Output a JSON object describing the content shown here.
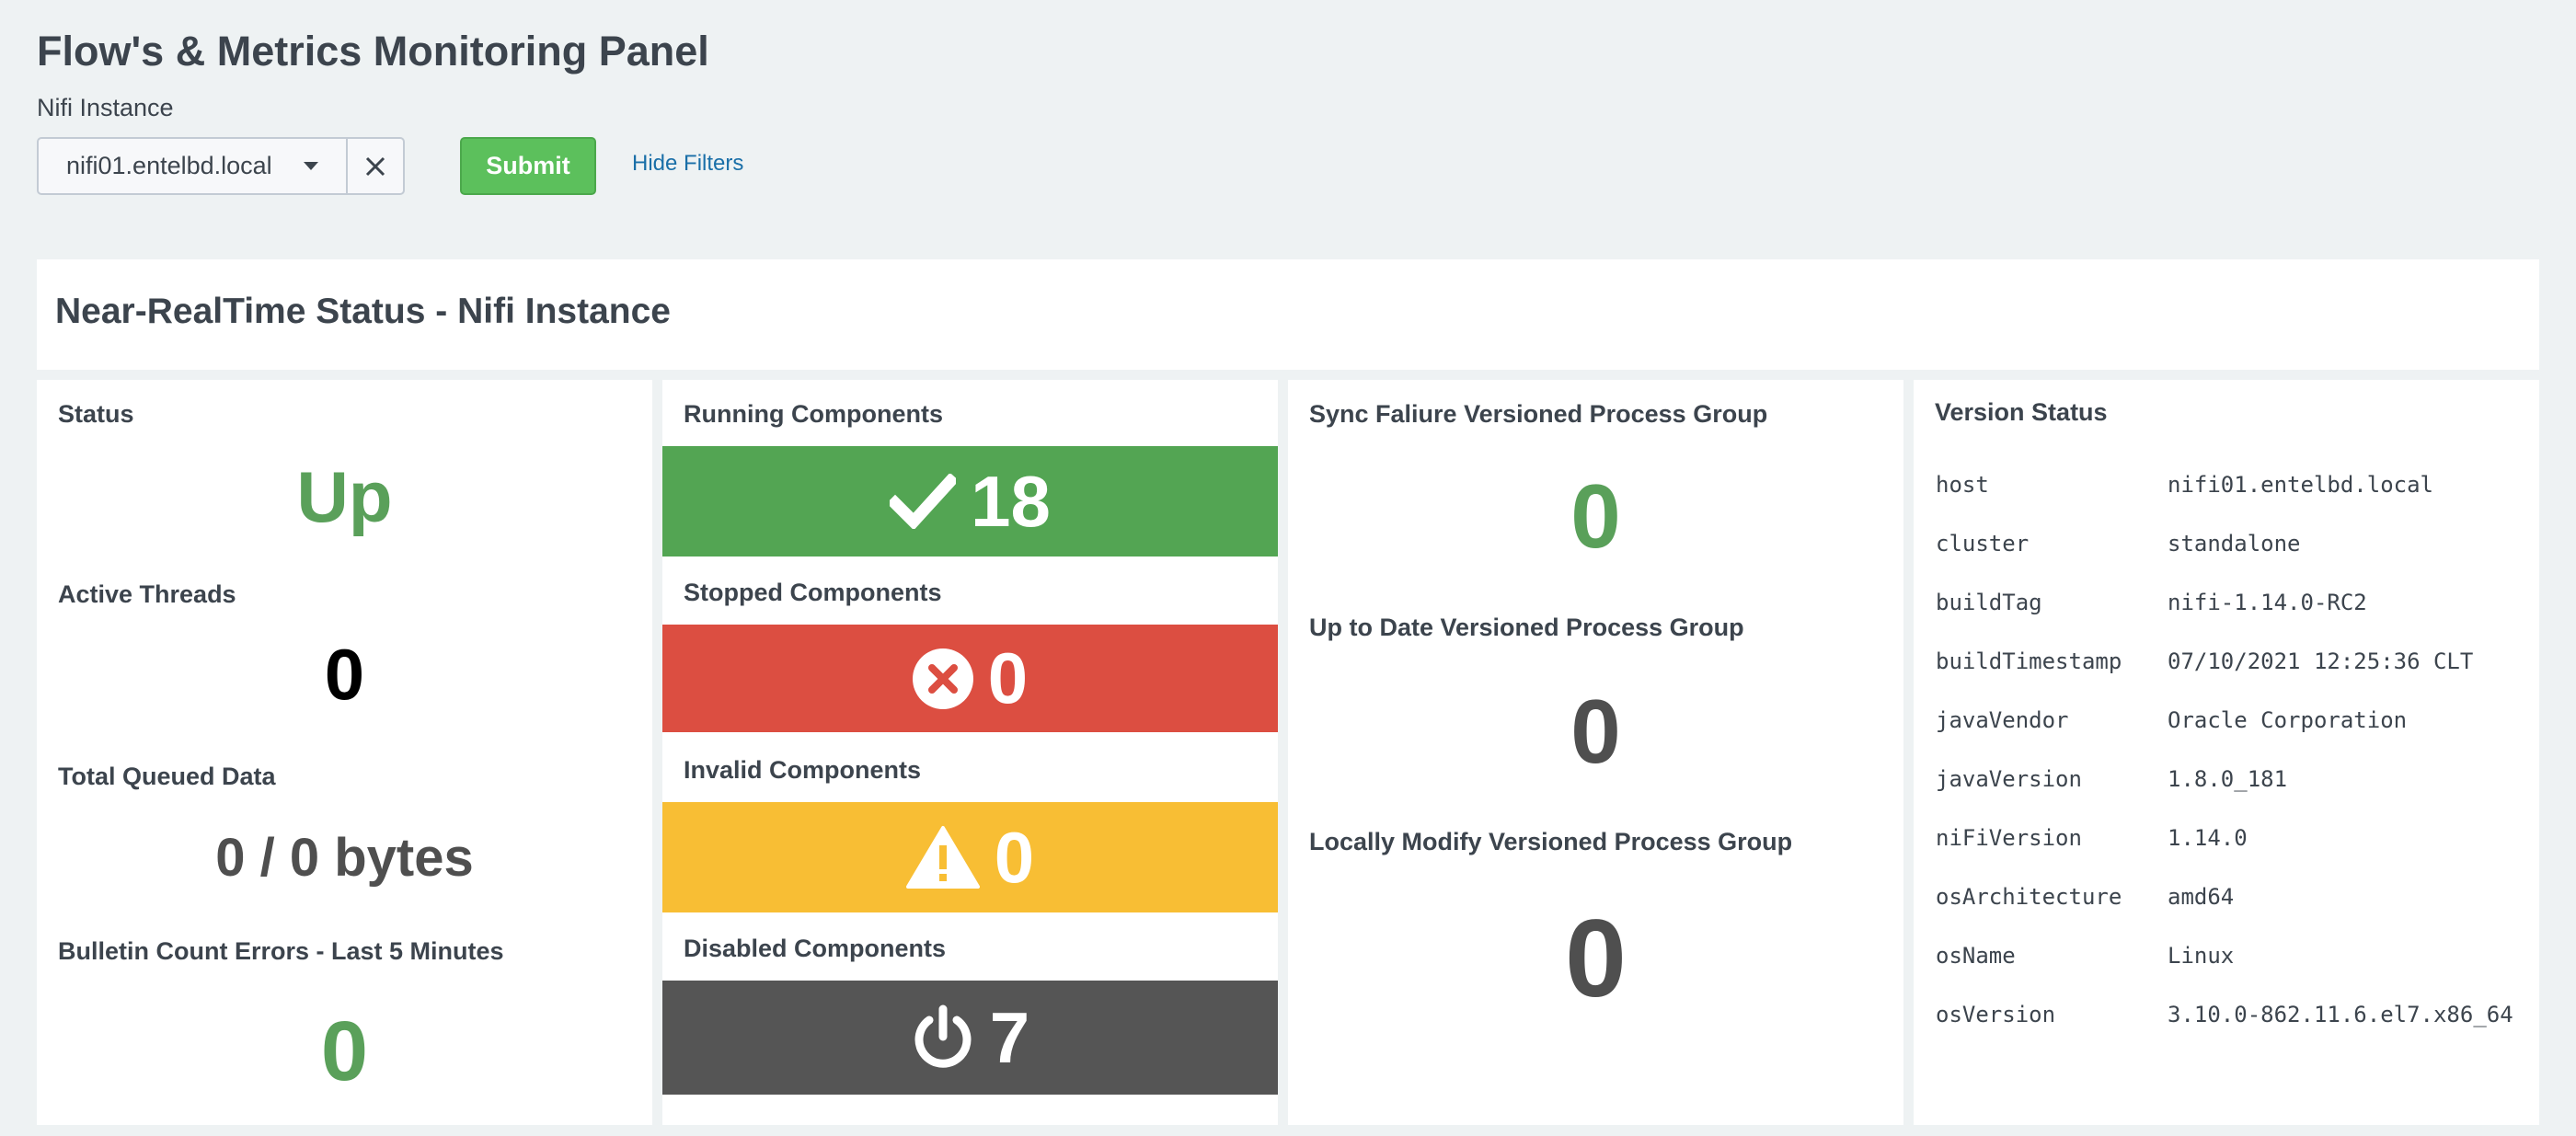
{
  "page": {
    "title": "Flow's & Metrics Monitoring Panel"
  },
  "filters": {
    "instance_label": "Nifi Instance",
    "instance_value": "nifi01.entelbd.local",
    "submit_label": "Submit",
    "hide_filters_label": "Hide Filters"
  },
  "section": {
    "title": "Near-RealTime Status - Nifi Instance"
  },
  "status_panel": {
    "status_label": "Status",
    "status_value": "Up",
    "threads_label": "Active Threads",
    "threads_value": "0",
    "queued_label": "Total Queued Data",
    "queued_value": "0 / 0 bytes",
    "bulletin_label": "Bulletin Count Errors - Last 5 Minutes",
    "bulletin_value": "0"
  },
  "components": {
    "running_label": "Running Components",
    "running_value": "18",
    "stopped_label": "Stopped Components",
    "stopped_value": "0",
    "invalid_label": "Invalid Components",
    "invalid_value": "0",
    "disabled_label": "Disabled Components",
    "disabled_value": "7"
  },
  "versioned": {
    "sync_failure_label": "Sync Faliure Versioned Process Group",
    "sync_failure_value": "0",
    "up_to_date_label": "Up to Date Versioned Process Group",
    "up_to_date_value": "0",
    "locally_modified_label": "Locally Modify Versioned Process Group",
    "locally_modified_value": "0"
  },
  "version_status": {
    "title": "Version Status",
    "rows": [
      {
        "key": "host",
        "value": "nifi01.entelbd.local"
      },
      {
        "key": "cluster",
        "value": "standalone"
      },
      {
        "key": "buildTag",
        "value": "nifi-1.14.0-RC2"
      },
      {
        "key": "buildTimestamp",
        "value": "07/10/2021 12:25:36 CLT"
      },
      {
        "key": "javaVendor",
        "value": "Oracle Corporation"
      },
      {
        "key": "javaVersion",
        "value": "1.8.0_181"
      },
      {
        "key": "niFiVersion",
        "value": "1.14.0"
      },
      {
        "key": "osArchitecture",
        "value": "amd64"
      },
      {
        "key": "osName",
        "value": "Linux"
      },
      {
        "key": "osVersion",
        "value": "3.10.0-862.11.6.el7.x86_64"
      }
    ]
  },
  "colors": {
    "ok_green": "#53a553",
    "value_green": "#5aa05a",
    "error_red": "#dc4e41",
    "warning_yellow": "#f8be34",
    "disabled_gray": "#555555",
    "neutral_value": "#4f4f4f"
  },
  "icons": {
    "running": "checkmark-icon",
    "stopped": "x-circle-icon",
    "invalid": "warning-triangle-icon",
    "disabled": "power-icon",
    "clear": "close-icon",
    "dropdown": "caret-down-icon"
  }
}
